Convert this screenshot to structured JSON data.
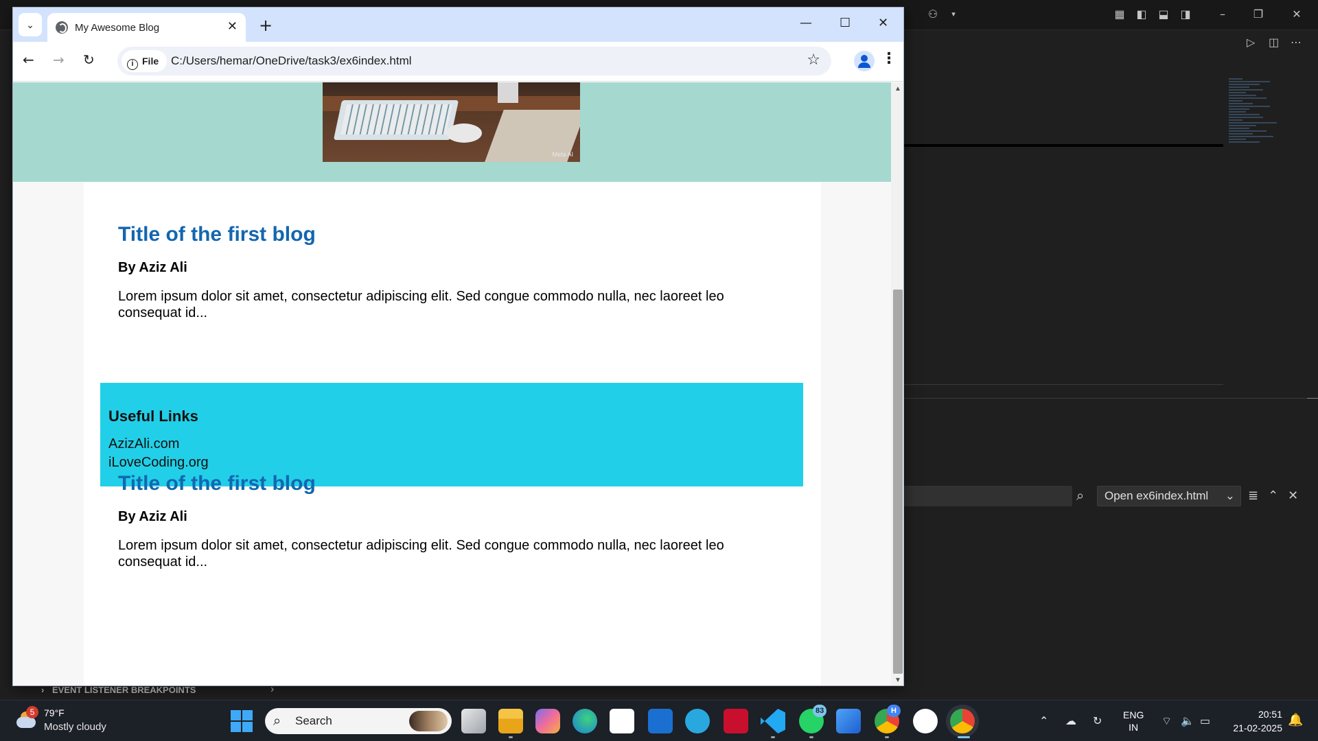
{
  "browser": {
    "tab_title": "My Awesome Blog",
    "new_tab": "+",
    "site_chip": "File",
    "url": "C:/Users/hemar/OneDrive/task3/ex6index.html"
  },
  "page": {
    "image_watermark": "Meta AI",
    "posts": [
      {
        "title": "Title of the first blog",
        "author": "By Aziz Ali",
        "excerpt": "Lorem ipsum dolor sit amet, consectetur adipiscing elit. Sed congue commodo nulla, nec laoreet leo consequat id..."
      },
      {
        "title": "Title of the first blog",
        "author": "By Aziz Ali",
        "excerpt": "Lorem ipsum dolor sit amet, consectetur adipiscing elit. Sed congue commodo nulla, nec laoreet leo consequat id..."
      }
    ],
    "useful_links": {
      "heading": "Useful Links",
      "links": [
        "AzizAli.com",
        "iLoveCoding.org"
      ]
    }
  },
  "editor": {
    "find_select": "Open ex6index.html",
    "debug_section": "EVENT LISTENER BREAKPOINTS"
  },
  "taskbar": {
    "weather_badge": "5",
    "temperature": "79°F",
    "condition": "Mostly cloudy",
    "search_label": "Search",
    "whatsapp_count": "83",
    "chrome_profile_badge": "H",
    "language": "ENG",
    "region": "IN",
    "time": "20:51",
    "date": "21-02-2025"
  },
  "colors": {
    "header_band": "#a5d9d0",
    "post_title": "#1366b0",
    "links_box": "#22cfe8",
    "tabstrip": "#d3e3fd"
  }
}
